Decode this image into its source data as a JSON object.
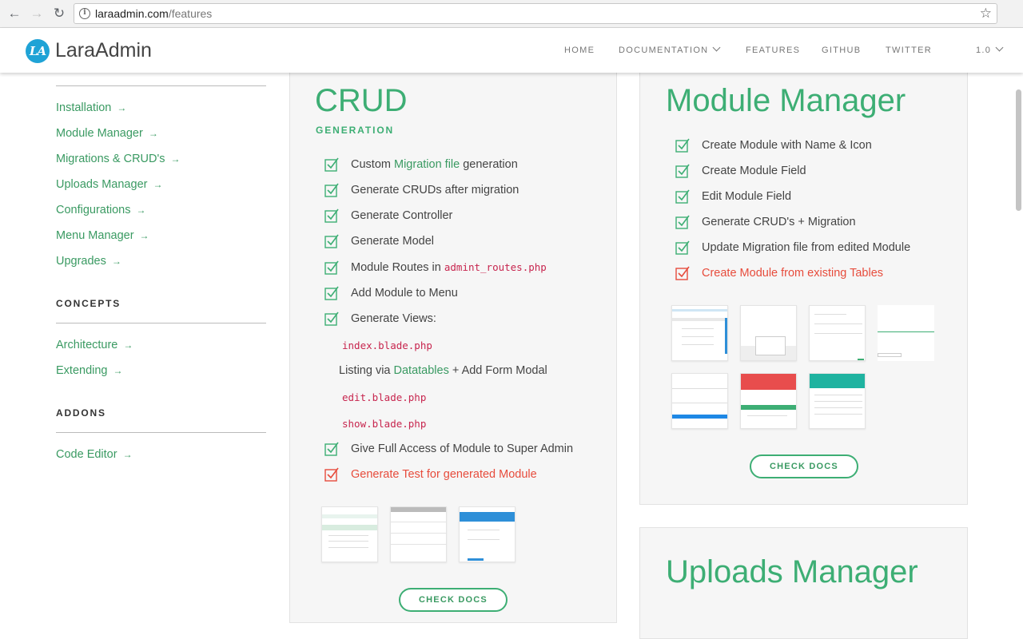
{
  "browser": {
    "url_host": "laraadmin.com",
    "url_path": "/features"
  },
  "header": {
    "logo_mark": "LA",
    "logo_text": "LaraAdmin",
    "nav": [
      "HOME",
      "DOCUMENTATION",
      "FEATURES",
      "GITHUB",
      "TWITTER"
    ],
    "version": "1.0"
  },
  "sidebar": {
    "links": [
      "Installation",
      "Module Manager",
      "Migrations & CRUD's",
      "Uploads Manager",
      "Configurations",
      "Menu Manager",
      "Upgrades"
    ],
    "concepts_heading": "CONCEPTS",
    "concepts": [
      "Architecture",
      "Extending"
    ],
    "addons_heading": "ADDONS",
    "addons": [
      "Code Editor"
    ]
  },
  "crud": {
    "title": "CRUD",
    "subtitle": "GENERATION",
    "f1_pre": "Custom ",
    "f1_link": "Migration file",
    "f1_post": " generation",
    "f2": "Generate CRUDs after migration",
    "f3": "Generate Controller",
    "f4": "Generate Model",
    "f5_pre": "Module Routes in ",
    "f5_code": "admint_routes.php",
    "f6": "Add Module to Menu",
    "f7": "Generate Views:",
    "v1": "index.blade.php",
    "v2_pre": "Listing via ",
    "v2_link": "Datatables",
    "v2_post": " + Add Form Modal",
    "v3": "edit.blade.php",
    "v4": "show.blade.php",
    "f8": "Give Full Access of Module to Super Admin",
    "f9": "Generate Test for generated Module",
    "button": "CHECK DOCS"
  },
  "module_manager": {
    "title": "Module Manager",
    "features": [
      "Create Module with Name & Icon",
      "Create Module Field",
      "Edit Module Field",
      "Generate CRUD's + Migration",
      "Update Migration file from edited Module"
    ],
    "pending": "Create Module from existing Tables",
    "button": "CHECK DOCS"
  },
  "uploads_manager": {
    "title": "Uploads Manager"
  },
  "colors": {
    "accent": "#3dae74",
    "pending": "#e74c3c",
    "code": "#c7254e"
  }
}
